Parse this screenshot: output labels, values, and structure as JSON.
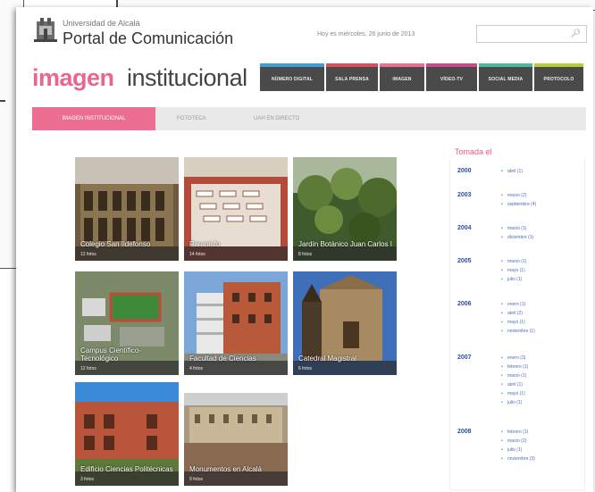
{
  "header": {
    "university_name": "Universidad de Alcalá",
    "portal_title": "Portal de Comunicación",
    "date_text": "Hoy es miércoles, 26 junio de 2013",
    "search_placeholder": ""
  },
  "brand": {
    "imagen": "imagen",
    "institucional": "institucional",
    "imagen_color": "#e8678a"
  },
  "top_nav": [
    {
      "label": "Número Digital",
      "color": "#3c9fd7"
    },
    {
      "label": "Sala Prensa",
      "color": "#e34a57"
    },
    {
      "label": "Imagen",
      "color": "#ec6f92"
    },
    {
      "label": "Vídeo-TV",
      "color": "#c94b8e"
    },
    {
      "label": "Social Media",
      "color": "#4abba0"
    },
    {
      "label": "Protocolo",
      "color": "#b8cc34"
    }
  ],
  "tabs": [
    {
      "label": "IMAGEN INSTITUCIONAL",
      "active": true
    },
    {
      "label": "FOTOTECA",
      "active": false
    },
    {
      "label": "UAH EN DIRECTO",
      "active": false
    }
  ],
  "gallery": [
    {
      "caption": "Colegio San Ildefonso",
      "count": "12 fotos"
    },
    {
      "caption": "Paraninfo",
      "count": "14 fotos"
    },
    {
      "caption": "Jardín Botánico Juan Carlos I",
      "count": "8 fotos"
    },
    {
      "caption": "Campus Científico-Tecnológico",
      "count": "12 fotos"
    },
    {
      "caption": "Facultad de Ciencias",
      "count": "4 fotos"
    },
    {
      "caption": "Catedral Magistral",
      "count": "6 fotos"
    },
    {
      "caption": "Edificio Ciencias Politécnicas",
      "count": "3 fotos"
    },
    {
      "caption": "Monumentos en Alcalá",
      "count": "9 fotos"
    }
  ],
  "sidebar": {
    "title": "Tomada el",
    "years": [
      {
        "year": "2000",
        "months": [
          "abril (1)"
        ]
      },
      {
        "year": "2003",
        "months": [
          "marzo (2)",
          "septiembre (4)"
        ]
      },
      {
        "year": "2004",
        "months": [
          "marzo (1)",
          "diciembre (1)"
        ]
      },
      {
        "year": "2005",
        "months": [
          "marzo (1)",
          "mayo (1)",
          "julio (1)"
        ]
      },
      {
        "year": "2006",
        "months": [
          "enero (1)",
          "abril (2)",
          "mayo (1)",
          "noviembre (1)"
        ]
      },
      {
        "year": "2007",
        "months": [
          "enero (3)",
          "febrero (1)",
          "marzo (1)",
          "abril (1)",
          "mayo (1)",
          "julio (1)"
        ]
      },
      {
        "year": "2008",
        "months": [
          "febrero (1)",
          "marzo (2)",
          "julio (1)",
          "noviembre (3)"
        ]
      }
    ]
  }
}
